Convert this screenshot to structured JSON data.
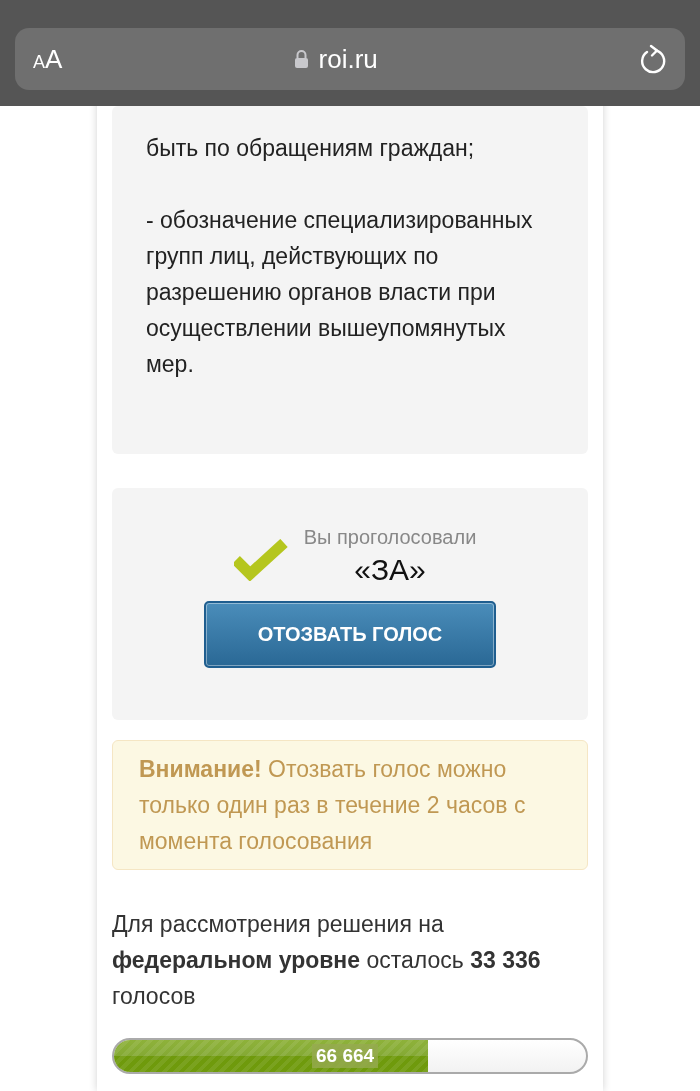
{
  "browser_bar": {
    "text_size_button": "AA",
    "address": "roi.ru"
  },
  "article": {
    "paragraphs": [
      "быть по обращениям граждан;",
      "- обозначение специализированных групп лиц, действующих по разрешению органов власти при осуществлении вышеупомянутых мер."
    ]
  },
  "vote": {
    "voted": true,
    "caption": "Вы проголосовали",
    "choice": "«ЗА»",
    "revoke_button": "ОТОЗВАТЬ ГОЛОС"
  },
  "warning": {
    "text": "**Внимание!** Отозвать голос можно только один раз в течение 2 часов с момента голосования"
  },
  "remaining": {
    "text": "Для рассмотрения решения на **федеральном уровне** осталось **33 336** голосов"
  },
  "progress": {
    "level": 0.665,
    "label": "66 664"
  }
}
